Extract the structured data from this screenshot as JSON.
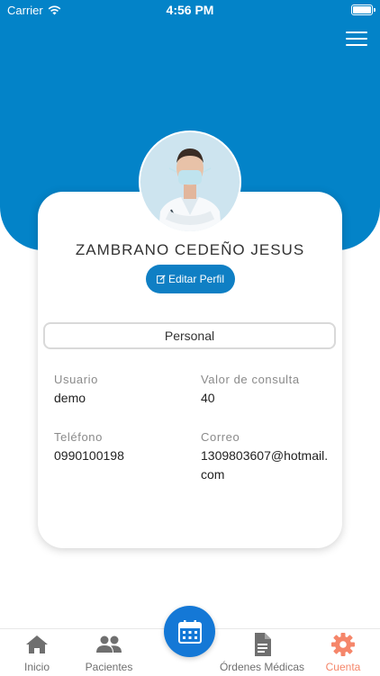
{
  "status_bar": {
    "carrier": "Carrier",
    "time": "4:56 PM"
  },
  "profile": {
    "name": "ZAMBRANO CEDEÑO JESUS",
    "edit_label": "Editar Perfil",
    "section_tab": "Personal",
    "fields": {
      "usuario_label": "Usuario",
      "usuario_value": "demo",
      "valor_label": "Valor de consulta",
      "valor_value": "40",
      "telefono_label": "Teléfono",
      "telefono_value": "0990100198",
      "correo_label": "Correo",
      "correo_value_line1": "1309803607@hotmail.",
      "correo_value_line2": "com"
    }
  },
  "nav": {
    "items": [
      {
        "label": "Inicio",
        "icon": "home-icon",
        "active": false
      },
      {
        "label": "Pacientes",
        "icon": "people-icon",
        "active": false
      },
      {
        "label": "Órdenes Médicas",
        "icon": "document-icon",
        "active": false
      },
      {
        "label": "Cuenta",
        "icon": "gear-icon",
        "active": true
      }
    ],
    "fab_icon": "calendar-icon"
  },
  "colors": {
    "primary": "#0383c8",
    "fab": "#1478d6",
    "active_tab": "#f5866a",
    "inactive_tab": "#6f6f6f"
  }
}
